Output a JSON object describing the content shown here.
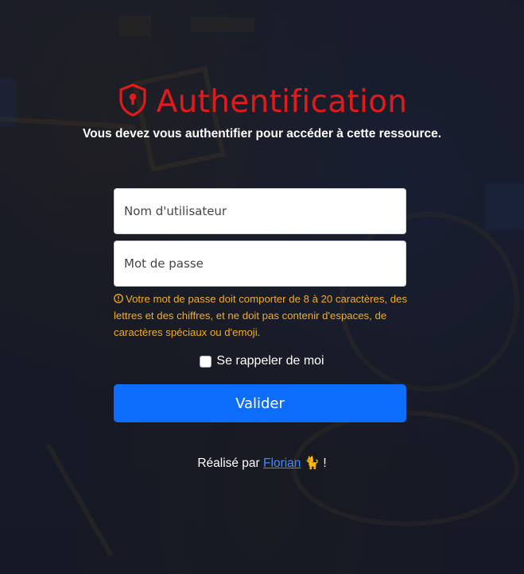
{
  "header": {
    "title": "Authentification",
    "subtitle": "Vous devez vous authentifier pour accéder à cette ressource."
  },
  "form": {
    "username_placeholder": "Nom d'utilisateur",
    "username_value": "",
    "password_placeholder": "Mot de passe",
    "password_value": "",
    "password_hint": "Votre mot de passe doit comporter de 8 à 20 caractères, des lettres et des chiffres, et ne doit pas contenir d'espaces, de caractères spéciaux ou d'emoji.",
    "remember_label": "Se rappeler de moi",
    "remember_checked": false,
    "submit_label": "Valider"
  },
  "footer": {
    "prefix": "Réalisé par",
    "author": "Florian",
    "emoji": "🐈",
    "suffix": "!"
  },
  "colors": {
    "title_red": "#e11b1b",
    "hint_amber": "#f0ad22",
    "primary_blue": "#0d6efd",
    "link_blue": "#3d8bfd",
    "background": "#1a1e2b"
  },
  "icons": {
    "title_icon": "shield-lock-icon",
    "hint_icon": "exclamation-circle-icon"
  }
}
